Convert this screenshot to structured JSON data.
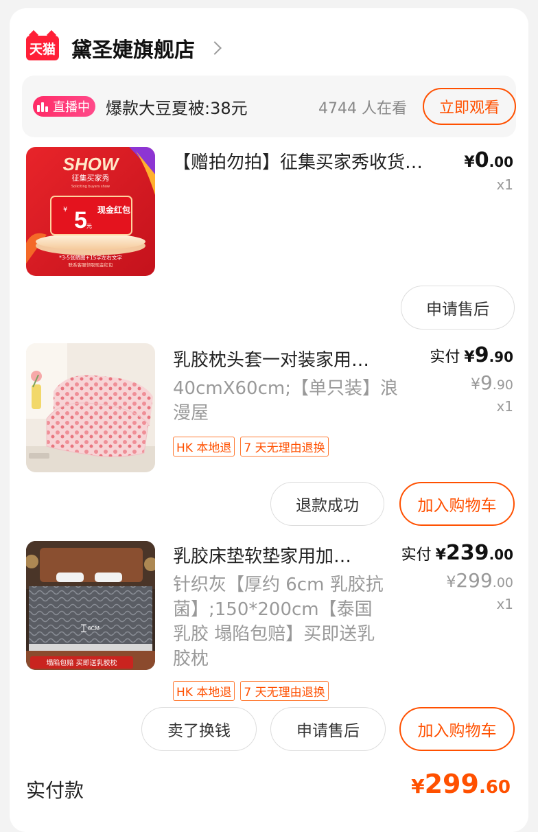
{
  "store": {
    "logo_text": "天猫",
    "name": "黛圣婕旗舰店"
  },
  "live": {
    "badge": "直播中",
    "title": "爆款大豆夏被:38元",
    "viewers": "4744 人在看",
    "watch_button": "立即观看"
  },
  "items": [
    {
      "title": "【赠拍勿拍】征集买家秀收货…",
      "price_yen": "¥",
      "price_int": "0",
      "price_dec": ".00",
      "qty": "x1",
      "image_text": {
        "show": "SHOW",
        "subtitle": "征集买家秀",
        "subtitle_en": "Soliciting buyers show",
        "coupon_yen": "¥",
        "coupon_amount": "5",
        "coupon_unit": "元",
        "coupon_label": "现金红包",
        "footer1": "*3-5张晒图+15字左右文字",
        "footer2": "联系客服领取现金红包"
      },
      "buttons": [
        "申请售后"
      ]
    },
    {
      "title": "乳胶枕头套一对装家用…",
      "spec": "40cmX60cm;【单只装】浪漫屋",
      "paid_label": "实付",
      "price_yen": "¥",
      "price_int": "9",
      "price_dec": ".90",
      "orig_yen": "¥",
      "orig_int": "9",
      "orig_dec": ".90",
      "qty": "x1",
      "tags": [
        "HK 本地退",
        "7 天无理由退换"
      ],
      "buttons": [
        "退款成功",
        "加入购物车"
      ]
    },
    {
      "title": "乳胶床垫软垫家用加…",
      "spec": "针织灰【厚约 6cm 乳胶抗菌】;150*200cm【泰国乳胶 塌陷包赔】买即送乳胶枕",
      "paid_label": "实付",
      "price_yen": "¥",
      "price_int": "239",
      "price_dec": ".00",
      "orig_yen": "¥",
      "orig_int": "299",
      "orig_dec": ".00",
      "qty": "x1",
      "image_text": {
        "size_mark": "6CM",
        "banner": "塌陷包赔 买即送乳胶枕"
      },
      "tags": [
        "HK 本地退",
        "7 天无理由退换"
      ],
      "buttons": [
        "卖了换钱",
        "申请售后",
        "加入购物车"
      ]
    }
  ],
  "total": {
    "label": "实付款",
    "yen": "¥",
    "int": "299",
    "dec": ".60"
  },
  "colors": {
    "accent": "#ff5000",
    "tmall_red": "#ff1f37",
    "live_pink": "#ff2b66"
  }
}
